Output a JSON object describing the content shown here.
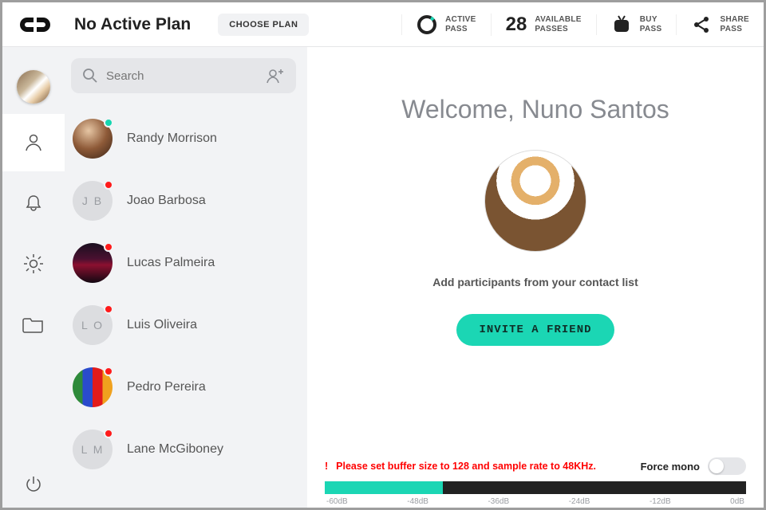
{
  "header": {
    "plan_title": "No Active Plan",
    "choose_plan_label": "CHOOSE PLAN",
    "stats": {
      "active": {
        "line1": "ACTIVE",
        "line2": "PASS"
      },
      "available": {
        "count": "28",
        "line1": "AVAILABLE",
        "line2": "PASSES"
      },
      "buy": {
        "line1": "BUY",
        "line2": "PASS"
      },
      "share": {
        "line1": "SHARE",
        "line2": "PASS"
      }
    }
  },
  "search": {
    "placeholder": "Search"
  },
  "contacts": [
    {
      "name": "Randy Morrison",
      "initials": "",
      "avatar_class": "av-photo1",
      "status": "green"
    },
    {
      "name": "Joao Barbosa",
      "initials": "J B",
      "avatar_class": "",
      "status": "red"
    },
    {
      "name": "Lucas Palmeira",
      "initials": "",
      "avatar_class": "av-photo2",
      "status": "red"
    },
    {
      "name": "Luis Oliveira",
      "initials": "L O",
      "avatar_class": "",
      "status": "red"
    },
    {
      "name": "Pedro Pereira",
      "initials": "",
      "avatar_class": "av-stripes",
      "status": "red"
    },
    {
      "name": "Lane McGiboney",
      "initials": "L M",
      "avatar_class": "",
      "status": "red"
    }
  ],
  "welcome": {
    "title": "Welcome, Nuno Santos",
    "subtitle": "Add participants from your contact list",
    "invite_label": "INVITE A FRIEND"
  },
  "audio": {
    "warning": "Please set buffer size to 128 and sample rate to 48KHz.",
    "force_mono_label": "Force mono",
    "meter_fill_percent": 28,
    "db_labels": [
      "-60dB",
      "-48dB",
      "-36dB",
      "-24dB",
      "-12dB",
      "0dB"
    ]
  },
  "colors": {
    "accent": "#1bd6b4"
  }
}
